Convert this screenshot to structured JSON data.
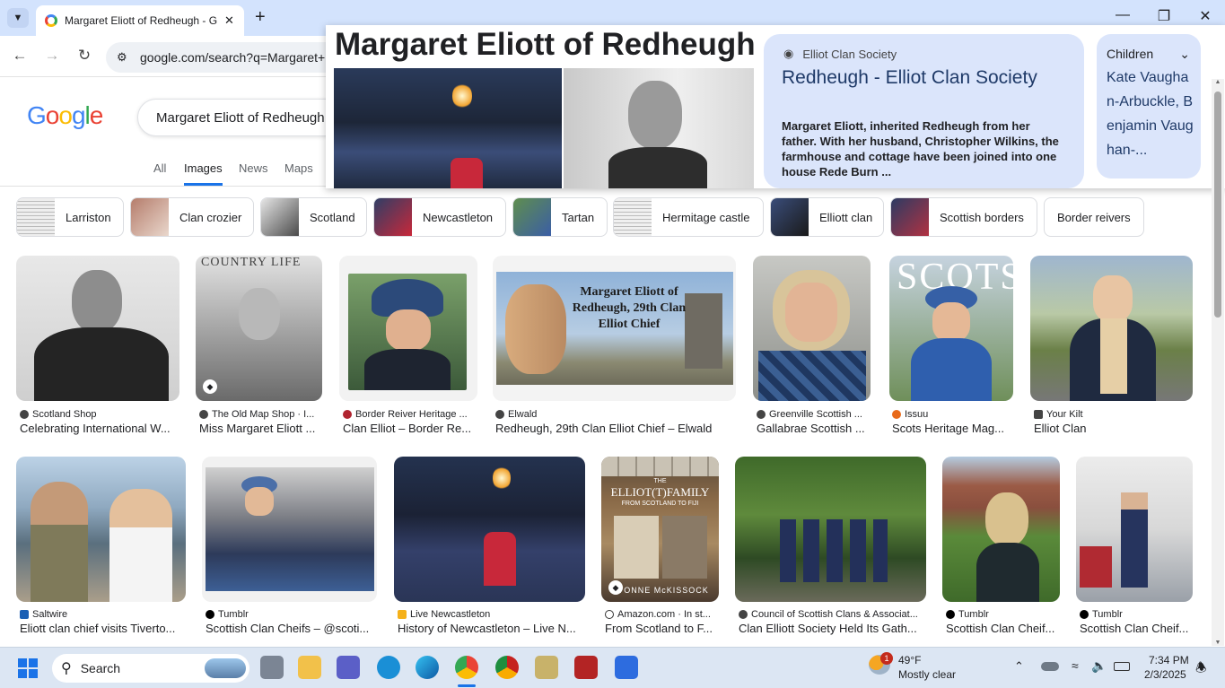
{
  "browser": {
    "tab_title": "Margaret Eliott of Redheugh - Goo",
    "new_tab": "+",
    "url": "google.com/search?q=Margaret+Eliott+of+Redheugh"
  },
  "google": {
    "logo": "Google",
    "query": "Margaret Eliott of Redheugh",
    "tabs": [
      "All",
      "Images",
      "News",
      "Maps"
    ]
  },
  "popup": {
    "heading": "Margaret Eliott of Redheugh",
    "site": "Elliot Clan Society",
    "title": "Redheugh - Elliot Clan Society",
    "snippet": "Margaret Eliott, inherited Redheugh from her father. With her husband, Christopher Wilkins, the farmhouse and cottage have been joined into one house Rede Burn ...",
    "children_label": "Children",
    "children_value": "Kate Vaughan-Arbuckle, Benjamin Vaughan-..."
  },
  "chips": [
    "Larriston",
    "Clan crozier",
    "Scotland",
    "Newcastleton",
    "Tartan",
    "Hermitage castle",
    "Elliott clan",
    "Scottish borders",
    "Border reivers"
  ],
  "row1": [
    {
      "source": "Scotland Shop",
      "title": "Celebrating International W..."
    },
    {
      "source": "The Old Map Shop · I...",
      "title": "Miss Margaret Eliott ...",
      "overlay": "COUNTRY  LIFE"
    },
    {
      "source": "Border Reiver Heritage ...",
      "title": "Clan Elliot – Border Re..."
    },
    {
      "source": "Elwald",
      "title": "Redheugh, 29th Clan Elliot Chief – Elwald",
      "overlay": "Margaret Eliott of Redheugh, 29th Clan Elliot Chief"
    },
    {
      "source": "Greenville Scottish ...",
      "title": "Gallabrae Scottish ..."
    },
    {
      "source": "Issuu",
      "title": "Scots Heritage Mag...",
      "overlay": "SCOTS"
    },
    {
      "source": "Your Kilt",
      "title": "Elliot Clan"
    }
  ],
  "row2": [
    {
      "source": "Saltwire",
      "title": "Eliott clan chief visits Tiverto..."
    },
    {
      "source": "Tumblr",
      "title": "Scottish Clan Cheifs – @scoti..."
    },
    {
      "source": "Live Newcastleton",
      "title": "History of Newcastleton – Live N..."
    },
    {
      "source": "Amazon.com · In st...",
      "title": "From Scotland to F...",
      "overlay_top": "THE",
      "overlay_main": "ELLIOT(T)FAMILY",
      "overlay_sub": "FROM SCOTLAND TO FIJI",
      "overlay_author": "YVONNE McKISSOCK"
    },
    {
      "source": "Council of Scottish Clans & Associat...",
      "title": "Clan Elliott Society Held Its Gath..."
    },
    {
      "source": "Tumblr",
      "title": "Scottish Clan Cheif..."
    },
    {
      "source": "Tumblr",
      "title": "Scottish Clan Cheif..."
    }
  ],
  "taskbar": {
    "search_placeholder": "Search",
    "weather_temp": "49°F",
    "weather_desc": "Mostly clear",
    "weather_badge": "1",
    "time": "7:34 PM",
    "date": "2/3/2025"
  }
}
